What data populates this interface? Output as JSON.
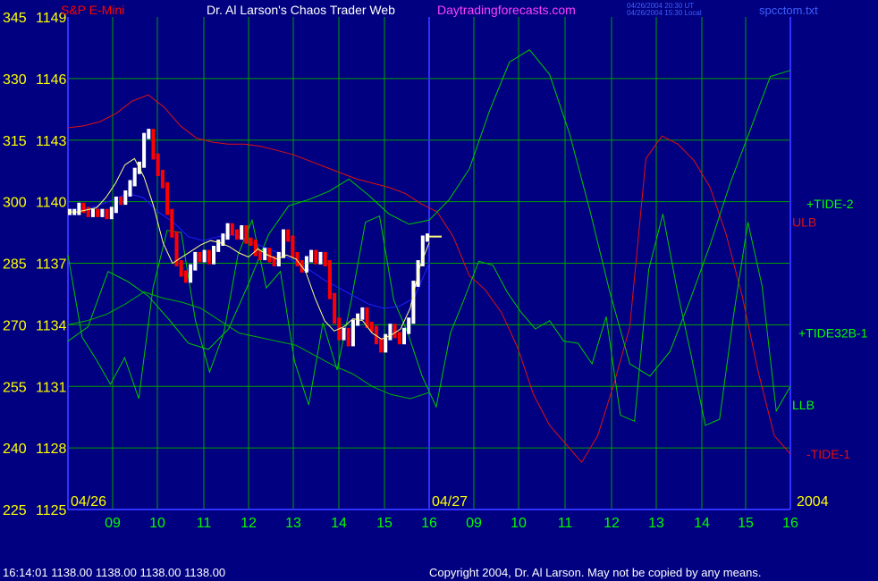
{
  "header": {
    "title_left": "S&P E-Mini",
    "title_center": "Dr. Al Larson's Chaos Trader Web",
    "site": "Daytradingforecasts.com",
    "stamp_ut": "04/26/2004 20:30 UT",
    "stamp_local": "04/26/2004 15:30 Local",
    "filename": "spcctom.txt"
  },
  "footer": {
    "quote": "16:14:01  1138.00 1138.00 1138.00 1138.00",
    "copyright": "Copyright 2004, Dr. Al Larson. May not be copied by any means."
  },
  "colors": {
    "background": "#000080",
    "grid": "#00a000",
    "axis": "#3030ff",
    "tick_text": "#ffff00",
    "date_text": "#00ff00",
    "bar_up": "#ffffff",
    "bar_down": "#ff0000",
    "tide_green": "#00c800",
    "tide_red": "#e01010",
    "bands": "#e01010",
    "llb_band": "#00b000",
    "blue_avg": "#2020ff",
    "yellow_avg": "#ffff80"
  },
  "chart_data": {
    "type": "line",
    "left_axis_ticks": [
      "345",
      "330",
      "315",
      "300",
      "285",
      "270",
      "255",
      "240",
      "225"
    ],
    "price_axis_ticks": [
      "1149",
      "1146",
      "1143",
      "1140",
      "1137",
      "1134",
      "1131",
      "1128",
      "1125"
    ],
    "x_ticks": [
      "09",
      "10",
      "11",
      "12",
      "13",
      "14",
      "15",
      "16",
      "09",
      "10",
      "11",
      "12",
      "13",
      "14",
      "15",
      "16"
    ],
    "date_labels": [
      "04/26",
      "04/27"
    ],
    "year_label": "2004",
    "ylim": [
      1125,
      1149
    ],
    "right_labels": {
      "tide2": "+TIDE-2",
      "ulb": "ULB",
      "tide32b": "+TIDE32B-1",
      "llb": "LLB",
      "tide1": "-TIDE-1"
    },
    "price_bars": [
      1139.5,
      1139.5,
      1139.8,
      1139.6,
      1139.4,
      1139.5,
      1139.4,
      1139.5,
      1139.3,
      1139.6,
      1140.1,
      1140.0,
      1140.4,
      1140.9,
      1141.5,
      1141.8,
      1143.2,
      1143.4,
      1142.2,
      1141.4,
      1140.8,
      1139.5,
      1138.4,
      1137.0,
      1136.5,
      1136.2,
      1136.8,
      1137.4,
      1137.2,
      1137.5,
      1137.1,
      1137.7,
      1138.0,
      1138.3,
      1138.8,
      1138.5,
      1138.3,
      1138.7,
      1138.1,
      1138.0,
      1137.5,
      1137.3,
      1137.6,
      1137.2,
      1137.0,
      1137.4,
      1138.5,
      1138.2,
      1137.4,
      1137.0,
      1136.7,
      1137.2,
      1137.5,
      1137.1,
      1137.4,
      1137.0,
      1135.4,
      1134.2,
      1133.4,
      1133.7,
      1133.1,
      1134.1,
      1134.4,
      1134.7,
      1134.0,
      1133.8,
      1133.2,
      1132.8,
      1133.4,
      1133.9,
      1133.5,
      1133.2,
      1133.7,
      1134.2,
      1136.0,
      1137.0,
      1138.2,
      1138.3
    ],
    "yellow_avg": [
      1139.5,
      1139.5,
      1139.6,
      1139.7,
      1140.2,
      1140.9,
      1141.8,
      1142.1,
      1141.2,
      1139.8,
      1138.0,
      1137.0,
      1137.3,
      1137.6,
      1137.9,
      1138.1,
      1138.0,
      1137.8,
      1137.5,
      1137.3,
      1137.7,
      1137.4,
      1137.2,
      1137.4,
      1137.2,
      1136.6,
      1135.3,
      1134.2,
      1133.7,
      1133.9,
      1134.3,
      1134.2,
      1133.6,
      1133.3,
      1133.5,
      1133.8,
      1134.8,
      1136.8,
      1138.0
    ],
    "blue_avg": [
      1139.6,
      1139.6,
      1139.8,
      1140.1,
      1140.4,
      1140.2,
      1139.5,
      1139.0,
      1138.3,
      1138.1,
      1138.3,
      1138.4,
      1138.1,
      1137.8,
      1137.5,
      1137.1,
      1136.7,
      1136.2,
      1135.8,
      1135.4,
      1135.0,
      1134.8,
      1134.9,
      1135.3,
      1137.0
    ],
    "ulb": [
      1143.6,
      1143.7,
      1143.9,
      1144.3,
      1144.9,
      1145.2,
      1144.6,
      1143.7,
      1143.1,
      1142.9,
      1142.8,
      1142.8,
      1142.7,
      1142.5,
      1142.3,
      1142.0,
      1141.7,
      1141.4,
      1141.1,
      1140.9,
      1140.7,
      1140.4,
      1139.9,
      1139.5,
      1138.3,
      1136.4,
      1135.7,
      1134.6,
      1132.9,
      1130.6,
      1129.1,
      1128.2,
      1127.3,
      1128.6,
      1131.1,
      1133.9,
      1142.1,
      1143.2,
      1142.8,
      1142.0,
      1140.7,
      1138.4,
      1135.4,
      1131.7,
      1128.6,
      1127.7
    ],
    "llb": [
      1134.0,
      1134.2,
      1134.5,
      1135.0,
      1135.6,
      1135.3,
      1135.1,
      1134.8,
      1134.2,
      1133.6,
      1133.4,
      1133.2,
      1133.0,
      1132.5,
      1132.0,
      1131.6,
      1131.0,
      1130.6,
      1130.4,
      1130.7
    ],
    "tide2": [
      1133.2,
      1133.9,
      1136.6,
      1136.1,
      1135.4,
      1134.3,
      1133.1,
      1132.8,
      1133.8,
      1136.0,
      1138.4,
      1139.8,
      1140.1,
      1140.5,
      1141.1,
      1140.3,
      1139.4,
      1138.9,
      1139.1,
      1140.1,
      1141.6,
      1144.4,
      1146.8,
      1147.4,
      1146.2,
      1143.3,
      1139.6,
      1135.6,
      1132.1,
      1131.5,
      1132.7,
      1135.2,
      1137.9,
      1140.9,
      1143.5,
      1146.1,
      1146.4
    ],
    "tide32b": [
      1137.4,
      1133.4,
      1132.3,
      1131.1,
      1132.4,
      1130.4,
      1135.8,
      1138.6,
      1138.5,
      1134.2,
      1131.7,
      1133.6,
      1137.4,
      1139.1,
      1135.8,
      1136.6,
      1132.2,
      1130.1,
      1134.1,
      1131.8,
      1135.2,
      1139.0,
      1139.3,
      1135.2,
      1133.6,
      1131.5,
      1130.0,
      1133.6,
      1135.3,
      1137.1,
      1136.9,
      1135.6,
      1134.6,
      1133.8,
      1134.2,
      1133.2,
      1133.1,
      1132.1,
      1134.4,
      1129.6,
      1129.3,
      1136.7,
      1139.4,
      1135.7,
      1132.5,
      1129.1,
      1129.4,
      1134.5,
      1139.0,
      1135.9,
      1129.8,
      1131.0
    ]
  }
}
